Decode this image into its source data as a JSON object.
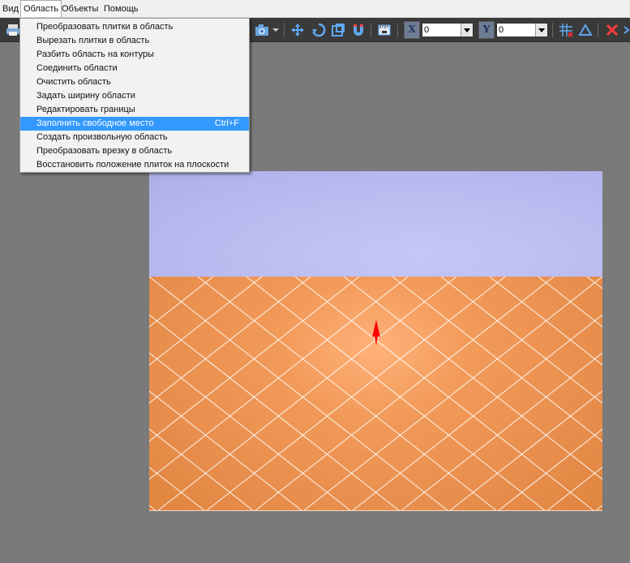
{
  "menubar": {
    "items": [
      {
        "label": "Вид"
      },
      {
        "label": "Область"
      },
      {
        "label": "Объекты"
      },
      {
        "label": "Помощь"
      }
    ]
  },
  "toolbar": {
    "x_label": "X",
    "x_value": "0",
    "y_label": "Y",
    "y_value": "0",
    "icons": [
      "printer-icon",
      "camera-icon",
      "move-icon",
      "rotate-icon",
      "scale-icon",
      "magnet-icon",
      "ruler-icon",
      "grid-icon",
      "triangle-icon",
      "delete-icon",
      "chevron-down-icon"
    ]
  },
  "dropdown_menu": {
    "items": [
      {
        "label": "Преобразовать плитки в область",
        "shortcut": ""
      },
      {
        "label": "Вырезать плитки в область",
        "shortcut": ""
      },
      {
        "label": "Разбить область на контуры",
        "shortcut": ""
      },
      {
        "label": "Соединить области",
        "shortcut": ""
      },
      {
        "label": "Очистить область",
        "shortcut": ""
      },
      {
        "label": "Задать ширину области",
        "shortcut": ""
      },
      {
        "label": "Редактировать границы",
        "shortcut": ""
      },
      {
        "label": "Заполнить свободное место",
        "shortcut": "Ctrl+F"
      },
      {
        "label": "Создать произвольную область",
        "shortcut": ""
      },
      {
        "label": "Преобразовать врезку в область",
        "shortcut": ""
      },
      {
        "label": "Восстановить положение плиток на плоскости",
        "shortcut": ""
      }
    ],
    "highlighted_index": 7
  },
  "colors": {
    "workspace": "#7a7a7a",
    "wall": "#b9b9ef",
    "floor_tile": "#e88e4d",
    "grout": "#ffffff",
    "highlight": "#3399ff",
    "marker": "#ff0000"
  }
}
